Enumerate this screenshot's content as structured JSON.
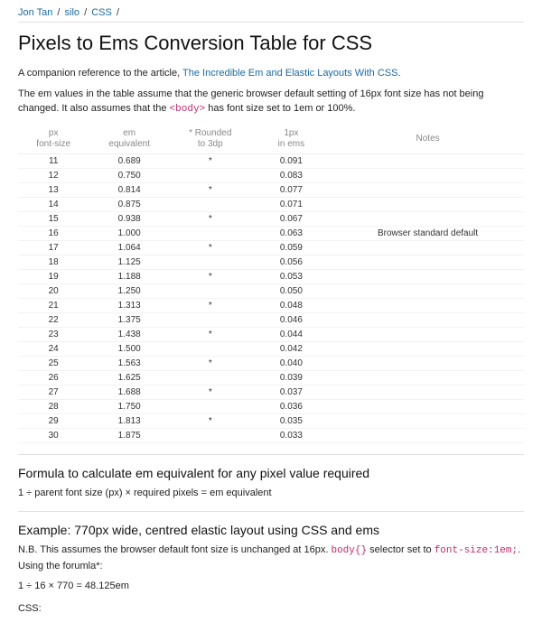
{
  "breadcrumb": {
    "items": [
      "Jon Tan",
      "silo",
      "CSS"
    ],
    "sep": "/"
  },
  "title": "Pixels to Ems Conversion Table for CSS",
  "intro": {
    "line1_pre": "A companion reference to the article, ",
    "line1_link": "The Incredible Em and Elastic Layouts With CSS",
    "line1_post": ".",
    "line2_pre": "The em values in the table assume that the generic browser default setting of 16px font size has not being changed. It also assumes that the ",
    "line2_code": "<body>",
    "line2_post": " has font size set to 1em or 100%."
  },
  "table": {
    "headers": {
      "px": "px\nfont-size",
      "em": "em\nequivalent",
      "rounded": "* Rounded\nto 3dp",
      "onepx": "1px\nin ems",
      "notes": "Notes"
    },
    "rows": [
      {
        "px": "11",
        "em": "0.689",
        "rd": "*",
        "onepx": "0.091",
        "notes": ""
      },
      {
        "px": "12",
        "em": "0.750",
        "rd": "",
        "onepx": "0.083",
        "notes": ""
      },
      {
        "px": "13",
        "em": "0.814",
        "rd": "*",
        "onepx": "0.077",
        "notes": ""
      },
      {
        "px": "14",
        "em": "0.875",
        "rd": "",
        "onepx": "0.071",
        "notes": ""
      },
      {
        "px": "15",
        "em": "0.938",
        "rd": "*",
        "onepx": "0.067",
        "notes": ""
      },
      {
        "px": "16",
        "em": "1.000",
        "rd": "",
        "onepx": "0.063",
        "notes": "Browser standard default"
      },
      {
        "px": "17",
        "em": "1.064",
        "rd": "*",
        "onepx": "0.059",
        "notes": ""
      },
      {
        "px": "18",
        "em": "1.125",
        "rd": "",
        "onepx": "0.056",
        "notes": ""
      },
      {
        "px": "19",
        "em": "1.188",
        "rd": "*",
        "onepx": "0.053",
        "notes": ""
      },
      {
        "px": "20",
        "em": "1.250",
        "rd": "",
        "onepx": "0.050",
        "notes": ""
      },
      {
        "px": "21",
        "em": "1.313",
        "rd": "*",
        "onepx": "0.048",
        "notes": ""
      },
      {
        "px": "22",
        "em": "1.375",
        "rd": "",
        "onepx": "0.046",
        "notes": ""
      },
      {
        "px": "23",
        "em": "1.438",
        "rd": "*",
        "onepx": "0.044",
        "notes": ""
      },
      {
        "px": "24",
        "em": "1.500",
        "rd": "",
        "onepx": "0.042",
        "notes": ""
      },
      {
        "px": "25",
        "em": "1.563",
        "rd": "*",
        "onepx": "0.040",
        "notes": ""
      },
      {
        "px": "26",
        "em": "1.625",
        "rd": "",
        "onepx": "0.039",
        "notes": ""
      },
      {
        "px": "27",
        "em": "1.688",
        "rd": "*",
        "onepx": "0.037",
        "notes": ""
      },
      {
        "px": "28",
        "em": "1.750",
        "rd": "",
        "onepx": "0.036",
        "notes": ""
      },
      {
        "px": "29",
        "em": "1.813",
        "rd": "*",
        "onepx": "0.035",
        "notes": ""
      },
      {
        "px": "30",
        "em": "1.875",
        "rd": "",
        "onepx": "0.033",
        "notes": ""
      }
    ]
  },
  "formula_section": {
    "heading": "Formula to calculate em equivalent for any pixel value required",
    "text": "1 ÷ parent font size (px) × required pixels = em equivalent"
  },
  "example_section": {
    "heading": "Example: 770px wide, centred elastic layout using CSS and ems",
    "nb_pre": "N.B. This assumes the browser default font size is unchanged at 16px. ",
    "nb_code1": "body{}",
    "nb_mid": " selector set to ",
    "nb_code2": "font-size:1em;",
    "nb_post": ". Using the forumla*:",
    "calc": "1 ÷ 16 × 770 = 48.125em",
    "css_label": "CSS:"
  },
  "chart_data": {
    "type": "table",
    "title": "Pixels to Ems Conversion Table for CSS",
    "columns": [
      "px font-size",
      "em equivalent",
      "Rounded to 3dp",
      "1px in ems",
      "Notes"
    ],
    "rows": [
      [
        11,
        0.689,
        true,
        0.091,
        ""
      ],
      [
        12,
        0.75,
        false,
        0.083,
        ""
      ],
      [
        13,
        0.814,
        true,
        0.077,
        ""
      ],
      [
        14,
        0.875,
        false,
        0.071,
        ""
      ],
      [
        15,
        0.938,
        true,
        0.067,
        ""
      ],
      [
        16,
        1.0,
        false,
        0.063,
        "Browser standard default"
      ],
      [
        17,
        1.064,
        true,
        0.059,
        ""
      ],
      [
        18,
        1.125,
        false,
        0.056,
        ""
      ],
      [
        19,
        1.188,
        true,
        0.053,
        ""
      ],
      [
        20,
        1.25,
        false,
        0.05,
        ""
      ],
      [
        21,
        1.313,
        true,
        0.048,
        ""
      ],
      [
        22,
        1.375,
        false,
        0.046,
        ""
      ],
      [
        23,
        1.438,
        true,
        0.044,
        ""
      ],
      [
        24,
        1.5,
        false,
        0.042,
        ""
      ],
      [
        25,
        1.563,
        true,
        0.04,
        ""
      ],
      [
        26,
        1.625,
        false,
        0.039,
        ""
      ],
      [
        27,
        1.688,
        true,
        0.037,
        ""
      ],
      [
        28,
        1.75,
        false,
        0.036,
        ""
      ],
      [
        29,
        1.813,
        true,
        0.035,
        ""
      ],
      [
        30,
        1.875,
        false,
        0.033,
        ""
      ]
    ]
  }
}
